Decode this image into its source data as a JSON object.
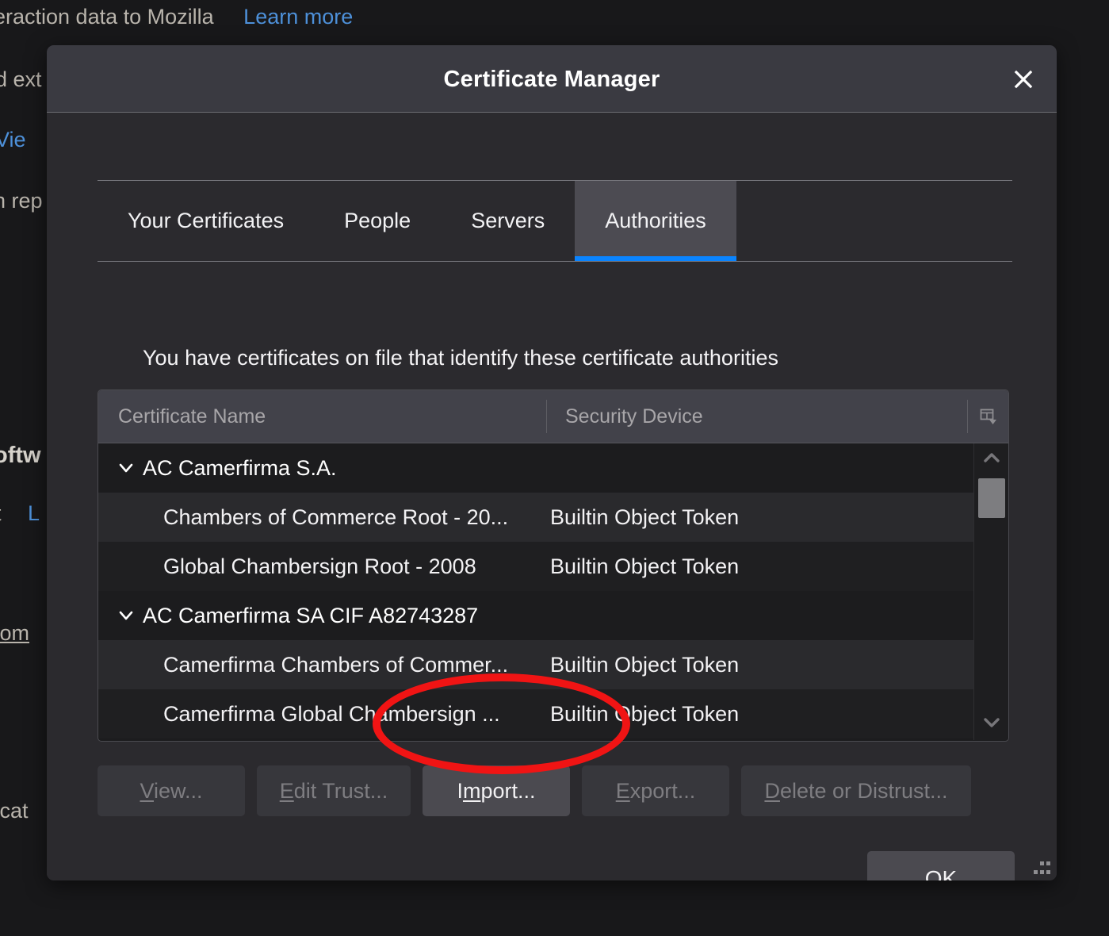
{
  "background_page": {
    "lines": [
      {
        "text": "eraction data to Mozilla",
        "link": "Learn more"
      },
      {
        "text": "d ext"
      },
      {
        "text": "Vie"
      },
      {
        "text": "n rep"
      },
      {
        "text": "oftw"
      },
      {
        "text": "t",
        "link": "L"
      },
      {
        "text": "com"
      },
      {
        "text": "ficat"
      }
    ],
    "link_color": "#4d90d9"
  },
  "dialog": {
    "title": "Certificate Manager",
    "close_icon": "close-icon",
    "tabs": [
      {
        "label": "Your Certificates",
        "selected": false
      },
      {
        "label": "People",
        "selected": false
      },
      {
        "label": "Servers",
        "selected": false
      },
      {
        "label": "Authorities",
        "selected": true
      }
    ],
    "selected_tab_accent": "#0a84ff",
    "description": "You have certificates on file that identify these certificate authorities",
    "table": {
      "columns": [
        "Certificate Name",
        "Security Device"
      ],
      "column_picker_icon": "column-picker-icon",
      "rows": [
        {
          "kind": "group",
          "name": "AC Camerfirma S.A.",
          "device": "",
          "expanded": true
        },
        {
          "kind": "leaf",
          "name": "Chambers of Commerce Root - 20...",
          "device": "Builtin Object Token"
        },
        {
          "kind": "leaf",
          "name": "Global Chambersign Root - 2008",
          "device": "Builtin Object Token"
        },
        {
          "kind": "group",
          "name": "AC Camerfirma SA CIF A82743287",
          "device": "",
          "expanded": true
        },
        {
          "kind": "leaf",
          "name": "Camerfirma Chambers of Commer...",
          "device": "Builtin Object Token"
        },
        {
          "kind": "leaf",
          "name": "Camerfirma Global Chambersign ...",
          "device": "Builtin Object Token"
        }
      ],
      "scrollbar": {
        "up_icon": "chevron-up-icon",
        "down_icon": "chevron-down-icon"
      }
    },
    "buttons": [
      {
        "id": "view",
        "label": "View...",
        "accesskey": "V",
        "disabled": true
      },
      {
        "id": "edit_trust",
        "label": "Edit Trust...",
        "accesskey": "E",
        "disabled": true
      },
      {
        "id": "import",
        "label": "Import...",
        "accesskey": "m",
        "disabled": false
      },
      {
        "id": "export",
        "label": "Export...",
        "accesskey": "E",
        "disabled": true
      },
      {
        "id": "delete",
        "label": "Delete or Distrust...",
        "accesskey": "D",
        "disabled": true
      }
    ],
    "ok_label": "OK",
    "resize_grip_icon": "resize-grip-icon"
  },
  "annotation": {
    "shape": "ellipse",
    "color": "#f01414",
    "targets_button": "Import..."
  }
}
